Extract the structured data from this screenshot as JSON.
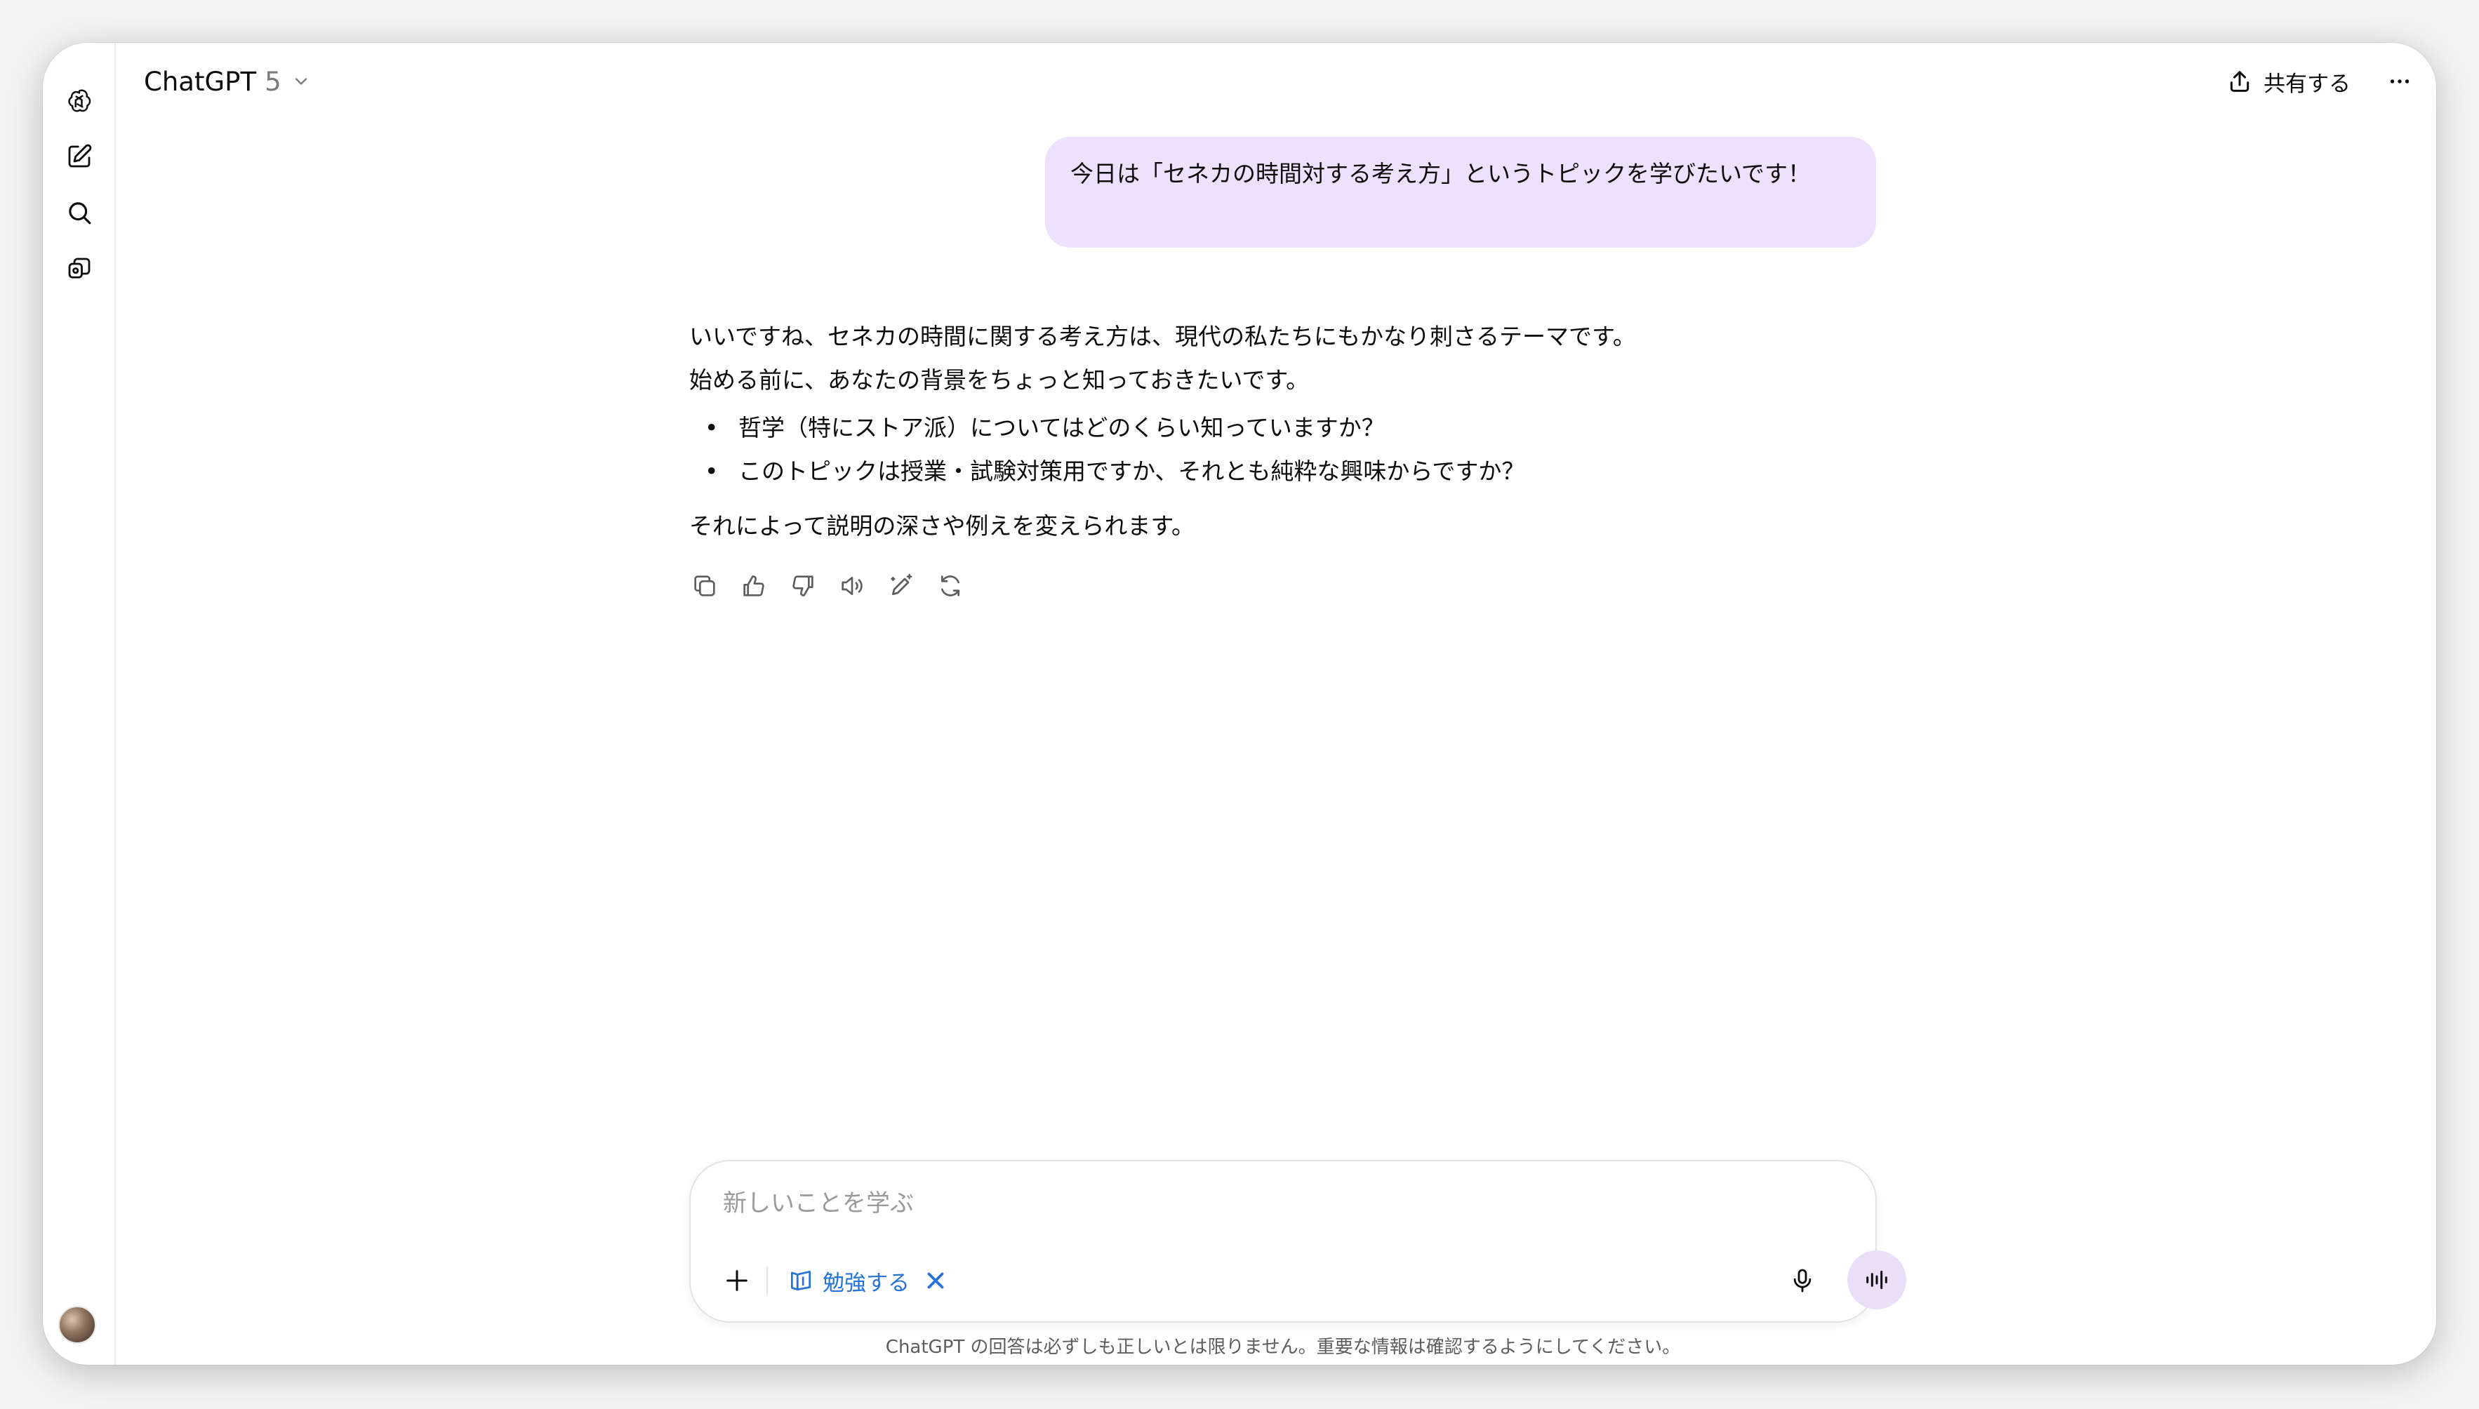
{
  "header": {
    "title": "ChatGPT",
    "version": "5",
    "share_label": "共有する"
  },
  "sidebar": {
    "items": [
      {
        "icon": "new-chat-icon"
      },
      {
        "icon": "search-icon"
      },
      {
        "icon": "library-icon"
      }
    ]
  },
  "conversation": {
    "user_message": "今日は「セネカの時間対する考え方」というトピックを学びたいです！",
    "assistant": {
      "para1": "いいですね、セネカの時間に関する考え方は、現代の私たちにもかなり刺さるテーマです。",
      "para2": "始める前に、あなたの背景をちょっと知っておきたいです。",
      "bullets": [
        "哲学（特にストア派）についてはどのくらい知っていますか？",
        "このトピックは授業・試験対策用ですか、それとも純粋な興味からですか？"
      ],
      "para3": "それによって説明の深さや例えを変えられます。"
    },
    "actions": [
      "copy-icon",
      "thumbs-up-icon",
      "thumbs-down-icon",
      "read-aloud-icon",
      "edit-icon",
      "regenerate-icon"
    ]
  },
  "composer": {
    "placeholder": "新しいことを学ぶ",
    "study_chip_label": "勉強する",
    "accent": "#2673d9",
    "voice_button_bg": "#eadff9"
  },
  "footer": {
    "disclaimer": "ChatGPT の回答は必ずしも正しいとは限りません。重要な情報は確認するようにしてください。"
  },
  "colors": {
    "user_bubble": "#ede2fd",
    "background": "#ffffff"
  }
}
